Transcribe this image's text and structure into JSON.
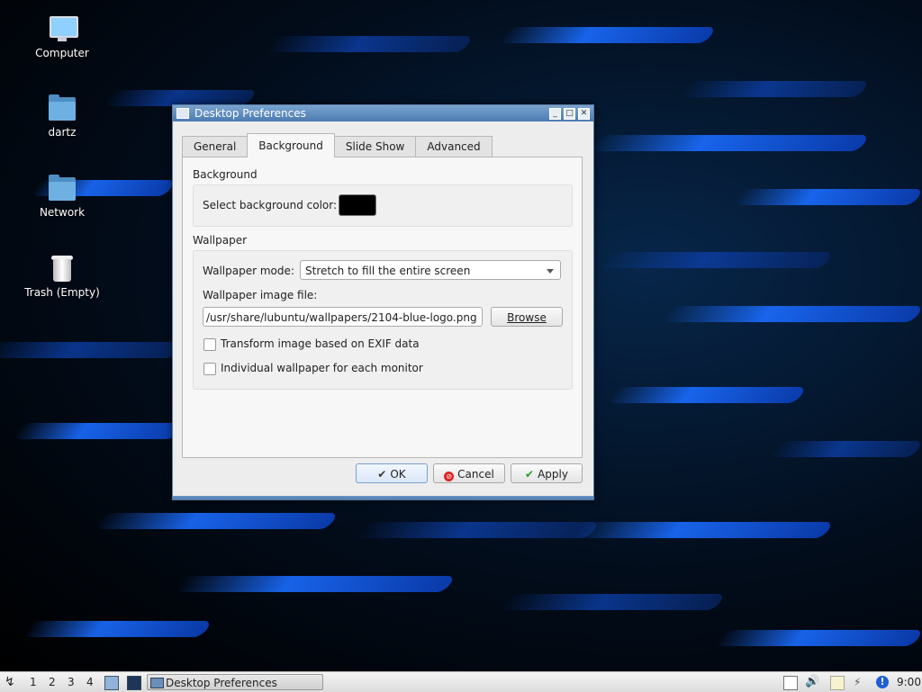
{
  "desktop": {
    "icons": [
      {
        "label": "Computer",
        "icon": "computer-icon"
      },
      {
        "label": "dartz",
        "icon": "home-folder-icon"
      },
      {
        "label": "Network",
        "icon": "network-folder-icon"
      },
      {
        "label": "Trash (Empty)",
        "icon": "trash-icon"
      }
    ]
  },
  "dialog": {
    "title": "Desktop Preferences",
    "tabs": [
      "General",
      "Background",
      "Slide Show",
      "Advanced"
    ],
    "active_tab": "Background",
    "background_group": {
      "title": "Background",
      "color_label": "Select background color:",
      "color_value": "#000000"
    },
    "wallpaper_group": {
      "title": "Wallpaper",
      "mode_label": "Wallpaper mode:",
      "mode_value": "Stretch to fill the entire screen",
      "file_label": "Wallpaper image file:",
      "file_value": "/usr/share/lubuntu/wallpapers/2104-blue-logo.png",
      "browse_label": "Browse",
      "exif_label": "Transform image based on EXIF data",
      "exif_checked": false,
      "per_monitor_label": "Individual wallpaper for each monitor",
      "per_monitor_checked": false
    },
    "buttons": {
      "ok": "OK",
      "cancel": "Cancel",
      "apply": "Apply"
    }
  },
  "taskbar": {
    "workspaces": [
      "1",
      "2",
      "3",
      "4"
    ],
    "task_label": "Desktop Preferences",
    "clock": "9:00"
  },
  "colors": {
    "accent": "#4b7bb2",
    "wallpaper_blue": "#1a6cff"
  }
}
